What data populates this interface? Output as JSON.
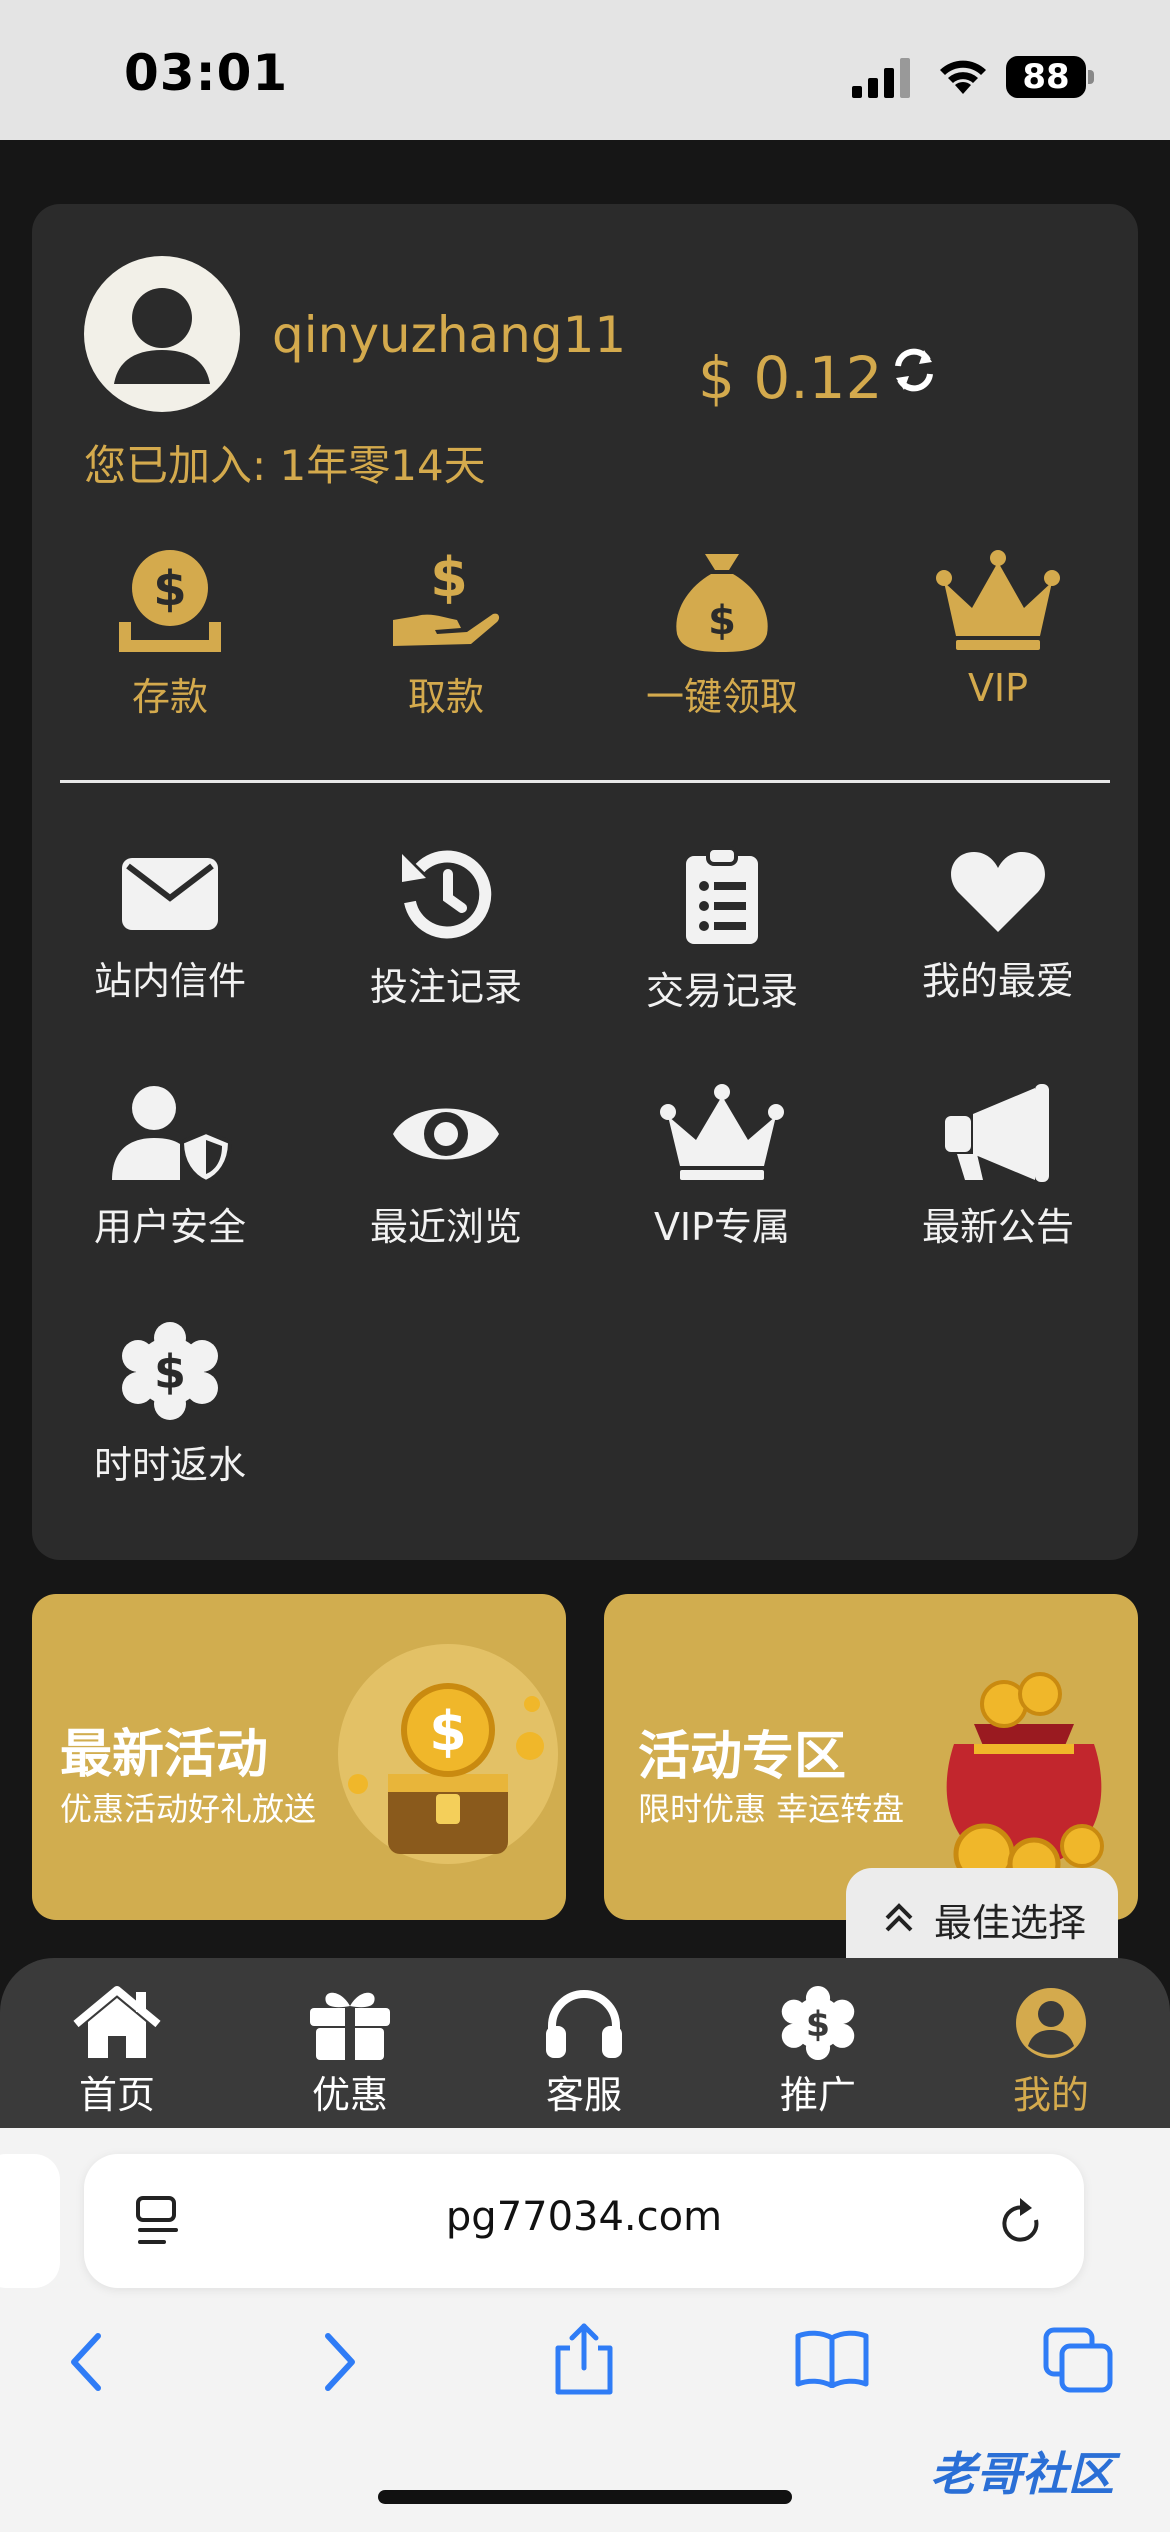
{
  "status_bar": {
    "time": "03:01",
    "battery": "88"
  },
  "account": {
    "username": "qinyuzhang11",
    "balance": "$ 0.12",
    "member_since": "您已加入: 1年零14天"
  },
  "wallet_actions": [
    {
      "label": "存款",
      "icon": "deposit-coins-icon"
    },
    {
      "label": "取款",
      "icon": "withdraw-hand-icon"
    },
    {
      "label": "一键领取",
      "icon": "money-bag-icon"
    },
    {
      "label": "VIP",
      "icon": "crown-icon"
    }
  ],
  "menu": [
    {
      "label": "站内信件",
      "icon": "envelope-icon"
    },
    {
      "label": "投注记录",
      "icon": "history-icon"
    },
    {
      "label": "交易记录",
      "icon": "clipboard-list-icon"
    },
    {
      "label": "我的最爱",
      "icon": "heart-icon"
    },
    {
      "label": "用户安全",
      "icon": "user-shield-icon"
    },
    {
      "label": "最近浏览",
      "icon": "eye-icon"
    },
    {
      "label": "VIP专属",
      "icon": "crown-icon"
    },
    {
      "label": "最新公告",
      "icon": "megaphone-icon"
    },
    {
      "label": "时时返水",
      "icon": "dollar-badge-icon"
    }
  ],
  "banners": [
    {
      "title": "最新活动",
      "subtitle": "优惠活动好礼放送"
    },
    {
      "title": "活动专区",
      "subtitle": "限时优惠 幸运转盘"
    }
  ],
  "best_choice": "最佳选择",
  "tabs": [
    {
      "label": "首页",
      "icon": "home-icon"
    },
    {
      "label": "优惠",
      "icon": "gift-icon"
    },
    {
      "label": "客服",
      "icon": "headset-icon"
    },
    {
      "label": "推广",
      "icon": "dollar-badge-icon"
    },
    {
      "label": "我的",
      "icon": "user-circle-icon",
      "active": true
    }
  ],
  "browser": {
    "url": "pg77034.com"
  },
  "watermark": "老哥社区",
  "colors": {
    "gold": "#d4aa4d",
    "card": "#2b2b2b",
    "background": "#161616",
    "banner": "#d1ad4f",
    "ios_blue": "#2f7cf6"
  }
}
